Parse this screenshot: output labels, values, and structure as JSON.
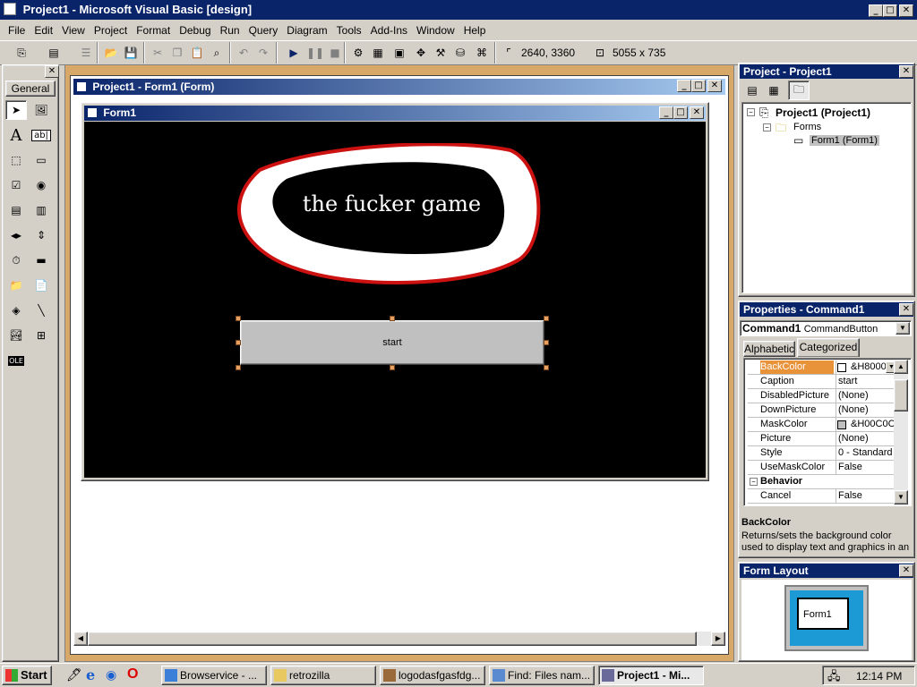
{
  "app": {
    "title": "Project1 - Microsoft Visual Basic [design]",
    "window_buttons": [
      "_",
      "□",
      "✕"
    ]
  },
  "menu": [
    "File",
    "Edit",
    "View",
    "Project",
    "Format",
    "Debug",
    "Run",
    "Query",
    "Diagram",
    "Tools",
    "Add-Ins",
    "Window",
    "Help"
  ],
  "toolbar": {
    "position": "2640, 3360",
    "size": "5055 x 735"
  },
  "toolbox": {
    "tab_label": "General"
  },
  "form_designer": {
    "title": "Project1 - Form1 (Form)",
    "form_caption": "Form1",
    "canvas_text": "the fucker game",
    "button_caption": "start"
  },
  "project_explorer": {
    "title": "Project - Project1",
    "root": "Project1 (Project1)",
    "folder": "Forms",
    "item": "Form1 (Form1)"
  },
  "properties": {
    "title": "Properties - Command1",
    "object_name": "Command1",
    "object_type": "CommandButton",
    "tabs": [
      "Alphabetic",
      "Categorized"
    ],
    "active_tab": "Categorized",
    "rows": [
      {
        "name": "BackColor",
        "value": "&H8000"
      },
      {
        "name": "Caption",
        "value": "start"
      },
      {
        "name": "DisabledPicture",
        "value": "(None)"
      },
      {
        "name": "DownPicture",
        "value": "(None)"
      },
      {
        "name": "MaskColor",
        "value": "&H00C0C0"
      },
      {
        "name": "Picture",
        "value": "(None)"
      },
      {
        "name": "Style",
        "value": "0 - Standard"
      },
      {
        "name": "UseMaskColor",
        "value": "False"
      },
      {
        "name": "Behavior",
        "value": ""
      },
      {
        "name": "Cancel",
        "value": "False"
      }
    ],
    "description_title": "BackColor",
    "description_text": "Returns/sets the background color used to display text and graphics in an"
  },
  "form_layout": {
    "title": "Form Layout",
    "form_label": "Form1"
  },
  "taskbar": {
    "start_label": "Start",
    "tasks": [
      "Browservice - ...",
      "retrozilla",
      "logodasfgasfdg...",
      "Find: Files nam...",
      "Project1 - Mi..."
    ],
    "clock": "12:14 PM"
  },
  "colors": {
    "title_active": "#0a246a",
    "desktop_bg": "#d4d0c8",
    "workspace_frame": "#d8a868",
    "canvas": "#000000",
    "oval_border": "#cc1111",
    "selected_prop": "#e8923a"
  }
}
